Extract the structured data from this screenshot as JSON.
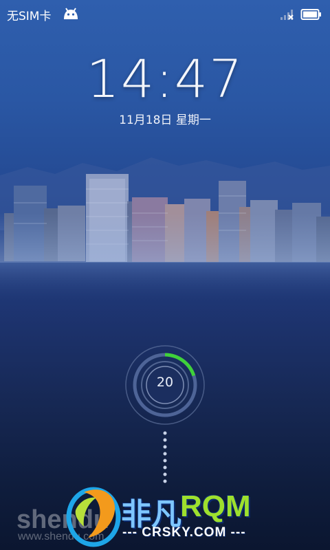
{
  "status_bar": {
    "carrier": "无SIM卡",
    "android_icon": "android-debug-icon",
    "signal_icon": "signal-no-sim-icon",
    "battery_icon": "battery-icon"
  },
  "lockscreen": {
    "time": "14:47",
    "date": "11月18日 星期一",
    "unlock_count": "20",
    "unlock_progress": 0.2,
    "accent_color": "#3fd13a"
  },
  "watermark": {
    "shendu": "shendu",
    "shendu_url": "www.shendu.com",
    "feifan": "非凡",
    "rom": "RQM",
    "crsky": "--- CRSKY.COM ---"
  }
}
